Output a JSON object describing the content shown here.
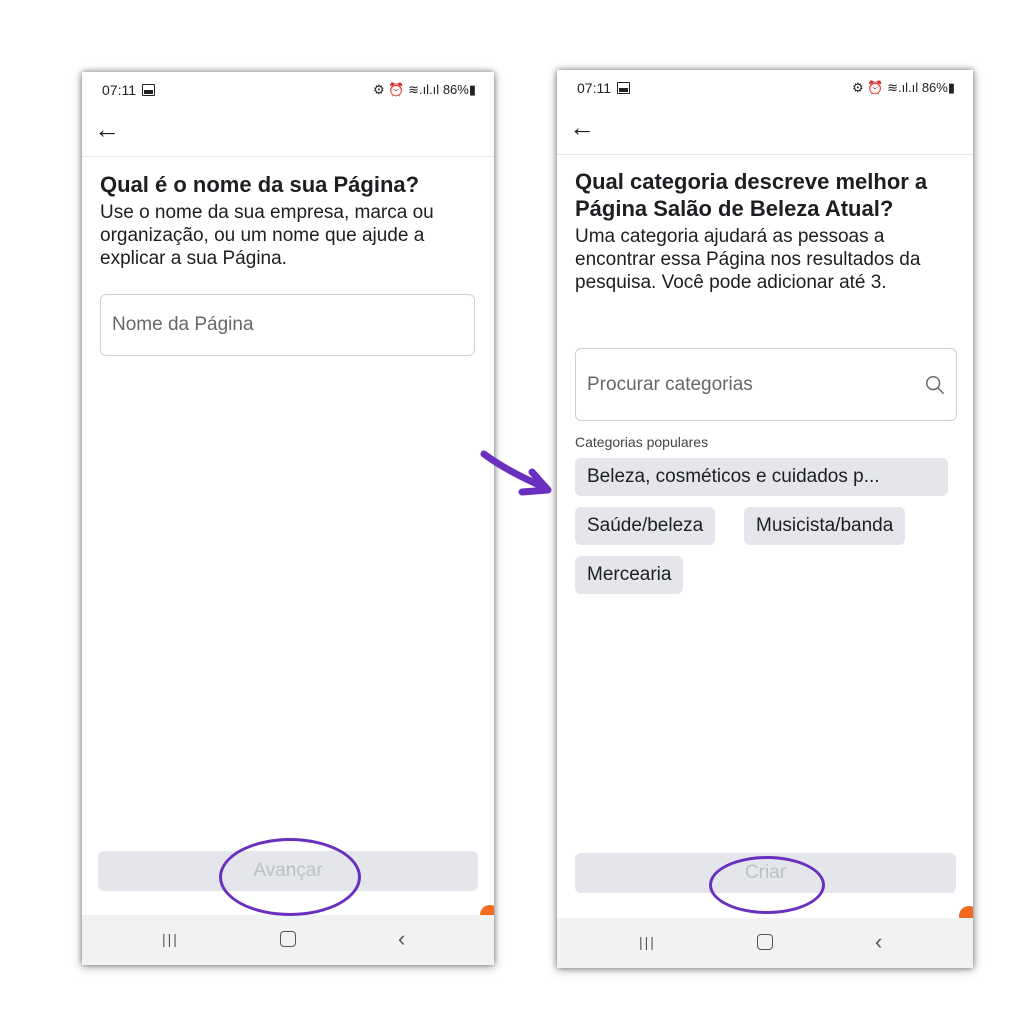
{
  "left_screen": {
    "status": {
      "time": "07:11",
      "icons": "⚙ ⏰ ≋.ıl.ıl",
      "battery": "86%"
    },
    "title": "Qual é o nome da sua Página?",
    "description": "Use o nome da sua empresa, marca ou organização, ou um nome que ajude a explicar a sua Página.",
    "input_placeholder": "Nome da Página",
    "next_button": "Avançar"
  },
  "right_screen": {
    "status": {
      "time": "07:11",
      "icons": "⚙ ⏰ ≋.ıl.ıl",
      "battery": "86%"
    },
    "title": "Qual categoria descreve melhor a Página Salão de Beleza Atual?",
    "description": "Uma categoria ajudará as pessoas a encontrar essa Página nos resultados da pesquisa. Você pode adicionar até 3.",
    "search_placeholder": "Procurar categorias",
    "popular_label": "Categorias populares",
    "chips": [
      "Beleza, cosméticos e cuidados p...",
      "Saúde/beleza",
      "Musicista/banda",
      "Mercearia"
    ],
    "create_button": "Criar"
  },
  "colors": {
    "highlight": "#6a2fbf",
    "disabled_button": "#e4e6eb",
    "chip": "#e4e6eb",
    "accent_dot": "#f26b21"
  },
  "icons": [
    "back-arrow-icon",
    "search-icon",
    "recent-apps-icon",
    "home-icon",
    "nav-back-icon",
    "arrow-icon"
  ]
}
